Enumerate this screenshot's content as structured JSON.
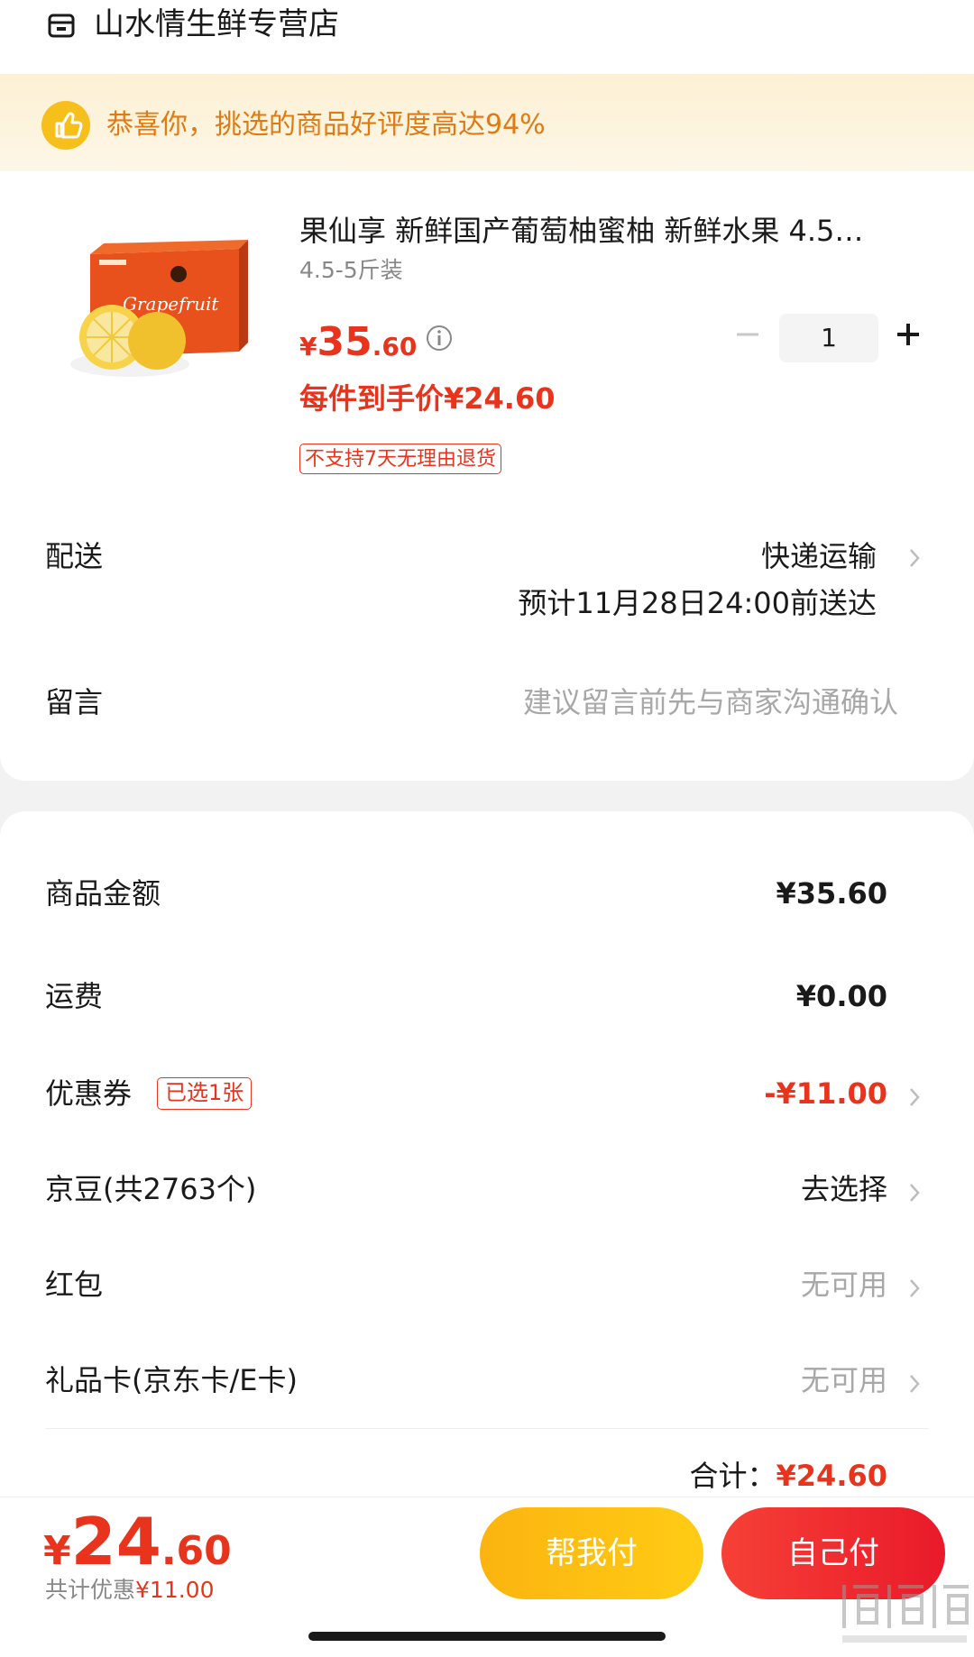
{
  "shop": {
    "icon": "store-icon",
    "name": "山水情生鲜专营店"
  },
  "promo": {
    "icon": "thumbs-up-icon",
    "text": "恭喜你，挑选的商品好评度高达94%"
  },
  "product": {
    "image_text": "Grapefruit",
    "title": "果仙享 新鲜国产葡萄柚蜜柚 新鲜水果 4.5…",
    "spec": "4.5-5斤装",
    "price_symbol": "¥",
    "price_int": "35",
    "price_dec": ".60",
    "quantity": "1",
    "unit_price": "每件到手价¥24.60",
    "tag": "不支持7天无理由退货"
  },
  "delivery": {
    "label": "配送",
    "method": "快递运输",
    "eta": "预计11月28日24:00前送达"
  },
  "message": {
    "label": "留言",
    "placeholder": "建议留言前先与商家沟通确认"
  },
  "summary": {
    "goods_label": "商品金额",
    "goods_value": "¥35.60",
    "shipping_label": "运费",
    "shipping_value": "¥0.00",
    "coupon_label": "优惠券",
    "coupon_tag": "已选1张",
    "coupon_value": "-¥11.00",
    "beans_label": "京豆(共2763个)",
    "beans_value": "去选择",
    "redpacket_label": "红包",
    "redpacket_value": "无可用",
    "giftcard_label": "礼品卡(京东卡/E卡)",
    "giftcard_value": "无可用",
    "total_label": "合计：",
    "total_value": "¥24.60"
  },
  "footer": {
    "pay_symbol": "¥",
    "pay_int": "24",
    "pay_dec": ".60",
    "discount_text": "共计优惠",
    "discount_value": "¥11.00",
    "help_pay": "帮我付",
    "self_pay": "自己付"
  },
  "watermark": "什么值得买",
  "colors": {
    "accent_red": "#e8341c",
    "yellow": "#fcb410",
    "orange_text": "#e07a12",
    "banner_bg": "#fdf0d4"
  }
}
